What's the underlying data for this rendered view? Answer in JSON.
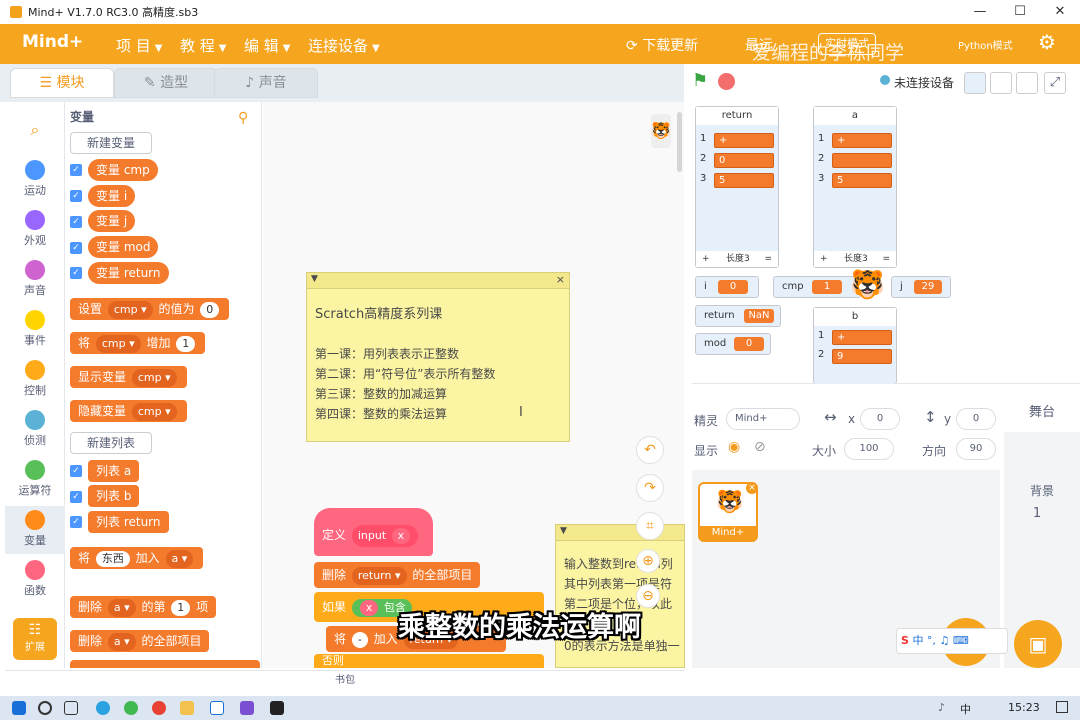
{
  "window": {
    "title": "Mind+ V1.7.0 RC3.0   高精度.sb3",
    "minimize": "—",
    "maximize": "☐",
    "close": "✕"
  },
  "menu": {
    "logo": "Mind+",
    "items": [
      "项 目",
      "教 程",
      "编 辑",
      "连接设备"
    ],
    "download": "下载更新",
    "mode_prefix": "最远",
    "mode_button": "实时模式",
    "python_label": "Python模式",
    "watermark": "爱编程的李栋同学"
  },
  "tabs": {
    "blocks": "模块",
    "costumes": "造型",
    "sounds": "声音"
  },
  "stage_bar": {
    "connection": "未连接设备"
  },
  "categories": [
    {
      "label": "运动",
      "color": "#4c97ff"
    },
    {
      "label": "外观",
      "color": "#9966ff"
    },
    {
      "label": "声音",
      "color": "#cf63cf"
    },
    {
      "label": "事件",
      "color": "#ffd500"
    },
    {
      "label": "控制",
      "color": "#ffab19"
    },
    {
      "label": "侦测",
      "color": "#5cb1d6"
    },
    {
      "label": "运算符",
      "color": "#59c059"
    },
    {
      "label": "变量",
      "color": "#ff8c1a"
    },
    {
      "label": "函数",
      "color": "#ff6680"
    }
  ],
  "extensions_label": "扩展",
  "palette": {
    "heading": "变量",
    "new_variable": "新建变量",
    "variables": [
      "变量 cmp",
      "变量 i",
      "变量 j",
      "变量 mod",
      "变量 return"
    ],
    "set_block": {
      "a": "设置",
      "var": "cmp",
      "b": "的值为",
      "val": "0"
    },
    "change_block": {
      "a": "将",
      "var": "cmp",
      "b": "增加",
      "val": "1"
    },
    "show_block": {
      "a": "显示变量",
      "var": "cmp"
    },
    "hide_block": {
      "a": "隐藏变量",
      "var": "cmp"
    },
    "new_list": "新建列表",
    "lists": [
      "列表 a",
      "列表 b",
      "列表 return"
    ],
    "add_block": {
      "a": "将",
      "val": "东西",
      "b": "加入",
      "var": "a"
    },
    "delete_block": {
      "a": "删除",
      "var": "a",
      "b": "的第",
      "val": "1",
      "c": "项"
    },
    "delete_all_block": {
      "a": "删除",
      "var": "a",
      "b": "的全部项目"
    }
  },
  "note1": {
    "lines": [
      "Scratch高精度系列课",
      "",
      "第一课：用列表表示正整数",
      "第二课：用“符号位”表示所有整数",
      "第三课：整数的加减运算",
      "第四课：整数的乘法运算"
    ]
  },
  "note2": {
    "lines": [
      "输入整数到return列",
      "其中列表第一项是符",
      "第二项是个位，以此",
      "0的表示方法是单独一"
    ]
  },
  "script": {
    "define": "定义",
    "define_name": "input",
    "param": "x",
    "delete_all": {
      "a": "删除",
      "var": "return",
      "b": "的全部项目"
    },
    "if": "如果",
    "if_param": "x",
    "if_op": "包含",
    "add": {
      "a": "将",
      "b": "加入",
      "var": "return"
    },
    "else": "否则"
  },
  "subtitle": "乘整数的乘法运算啊",
  "stage": {
    "list_return": {
      "title": "return",
      "items": [
        "+",
        "0",
        "5"
      ],
      "length": "长度3"
    },
    "list_a": {
      "title": "a",
      "items": [
        "+",
        "",
        "5"
      ],
      "length": "长度3"
    },
    "list_b": {
      "title": "b",
      "items": [
        "+",
        "9"
      ]
    },
    "monitors": {
      "i": "0",
      "cmp": "1",
      "j": "29",
      "return": "NaN",
      "mod": "0"
    },
    "list_plus": "+",
    "list_eq": "="
  },
  "sprite_info": {
    "sprite_label": "精灵",
    "sprite_name": "Mind+",
    "x_label": "x",
    "x": "0",
    "y_label": "y",
    "y": "0",
    "show_label": "显示",
    "size_label": "大小",
    "size": "100",
    "direction_label": "方向",
    "direction": "90"
  },
  "sprites": [
    {
      "name": "Mind+"
    }
  ],
  "stage_panel": {
    "title": "舞台",
    "backdrop_label": "背景",
    "backdrop_count": "1"
  },
  "backpack": "书包",
  "taskbar": {
    "time": "15:23",
    "ime": "中",
    "ime2": "中"
  }
}
